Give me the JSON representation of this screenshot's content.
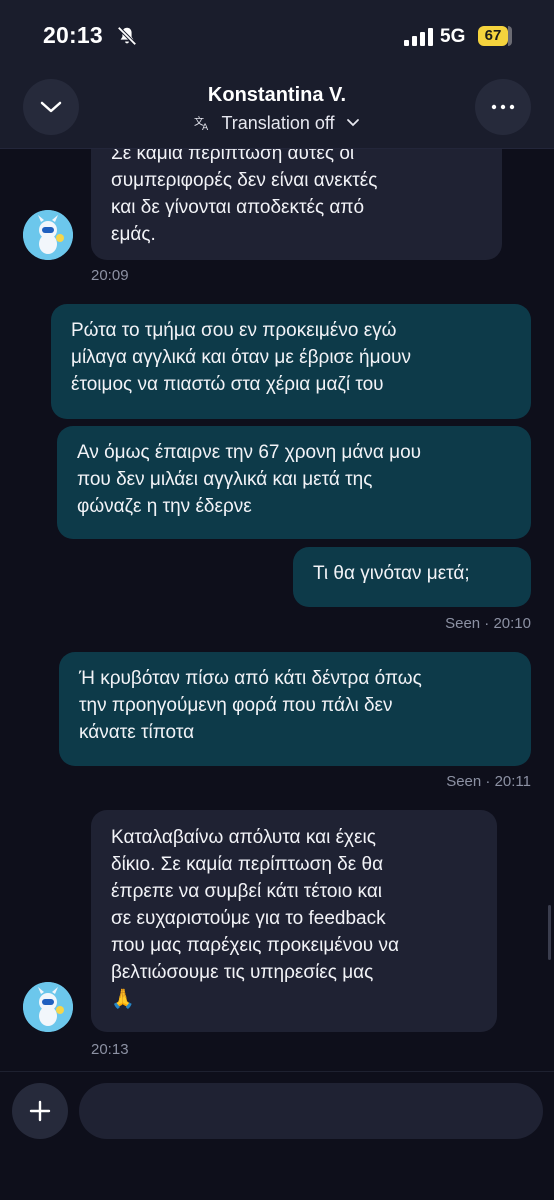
{
  "status_bar": {
    "time": "20:13",
    "network": "5G",
    "battery": "67"
  },
  "header": {
    "contact_name": "Konstantina V.",
    "translation_label": "Translation off"
  },
  "messages": [
    {
      "lines": [
        "Σε καμία περίπτωση αυτές οι",
        "συμπεριφορές δεν είναι ανεκτές",
        "και δε γίνονται αποδεκτές από",
        "εμάς."
      ]
    },
    {
      "lines": [
        "Ρώτα το τμήμα σου εν προκειμένο εγώ",
        "μίλαγα αγγλικά και όταν με έβρισε ήμουν",
        "έτοιμος να πιαστώ στα χέρια μαζί του"
      ]
    },
    {
      "lines": [
        "Αν όμως έπαιρνε την 67 χρονη μάνα μου",
        "που δεν μιλάει αγγλικά και μετά της",
        "φώναζε η την έδερνε"
      ]
    },
    {
      "lines": [
        "Τι θα γινόταν μετά;"
      ]
    },
    {
      "lines": [
        "Ή κρυβόταν πίσω από κάτι δέντρα όπως",
        "την προηγούμενη φορά που πάλι δεν",
        "κάνατε τίποτα"
      ]
    },
    {
      "lines": [
        "Καταλαβαίνω απόλυτα και έχεις",
        "δίκιο. Σε καμία περίπτωση δε θα",
        "έπρεπε να συμβεί κάτι τέτοιο και",
        "σε ευχαριστούμε για το feedback",
        "που μας παρέχεις προκειμένου να",
        "βελτιώσουμε τις υπηρεσίες μας",
        "🙏"
      ]
    }
  ],
  "timestamps": {
    "first_in": "20:09",
    "seen_1": "Seen · 20:10",
    "seen_2": "Seen · 20:11",
    "last_in": "20:13"
  },
  "composer": {
    "placeholder": ""
  },
  "colors": {
    "incoming_bubble": "#1f2233",
    "outgoing_bubble": "#0d3a49",
    "background": "#0e0f1b"
  }
}
